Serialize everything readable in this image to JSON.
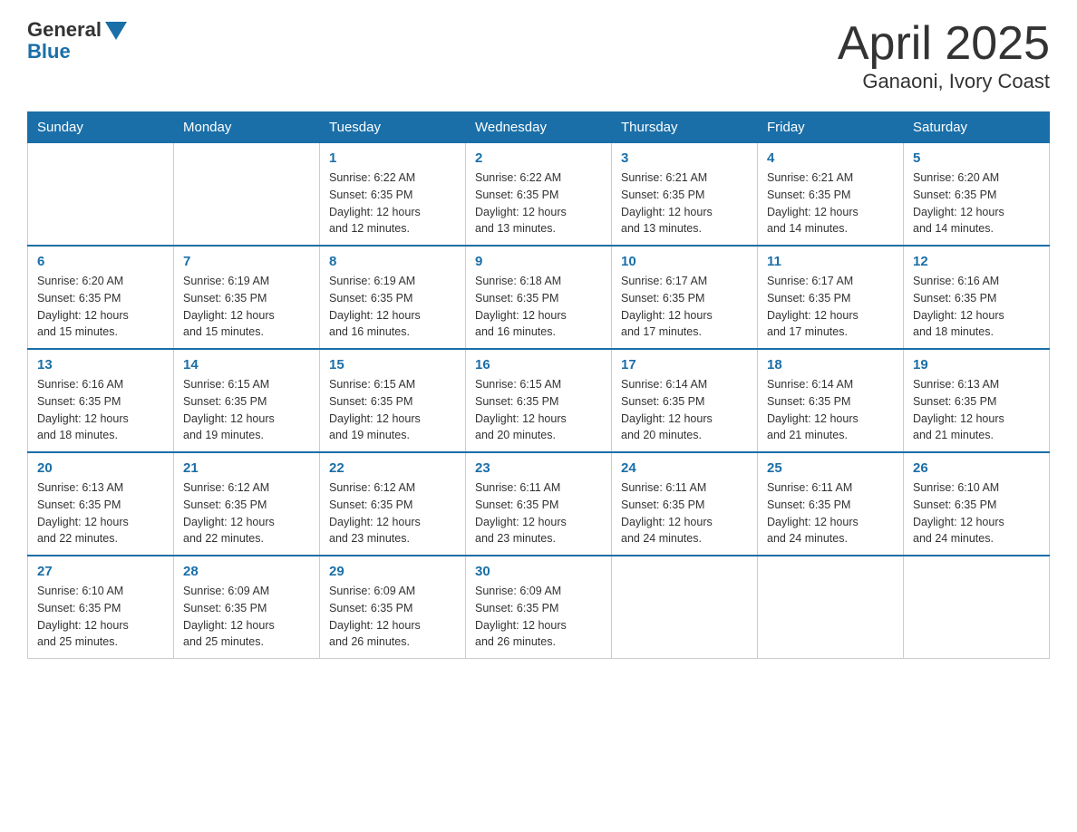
{
  "header": {
    "logo_general": "General",
    "logo_blue": "Blue",
    "title": "April 2025",
    "subtitle": "Ganaoni, Ivory Coast"
  },
  "days_of_week": [
    "Sunday",
    "Monday",
    "Tuesday",
    "Wednesday",
    "Thursday",
    "Friday",
    "Saturday"
  ],
  "weeks": [
    [
      {
        "day": "",
        "info": ""
      },
      {
        "day": "",
        "info": ""
      },
      {
        "day": "1",
        "info": "Sunrise: 6:22 AM\nSunset: 6:35 PM\nDaylight: 12 hours\nand 12 minutes."
      },
      {
        "day": "2",
        "info": "Sunrise: 6:22 AM\nSunset: 6:35 PM\nDaylight: 12 hours\nand 13 minutes."
      },
      {
        "day": "3",
        "info": "Sunrise: 6:21 AM\nSunset: 6:35 PM\nDaylight: 12 hours\nand 13 minutes."
      },
      {
        "day": "4",
        "info": "Sunrise: 6:21 AM\nSunset: 6:35 PM\nDaylight: 12 hours\nand 14 minutes."
      },
      {
        "day": "5",
        "info": "Sunrise: 6:20 AM\nSunset: 6:35 PM\nDaylight: 12 hours\nand 14 minutes."
      }
    ],
    [
      {
        "day": "6",
        "info": "Sunrise: 6:20 AM\nSunset: 6:35 PM\nDaylight: 12 hours\nand 15 minutes."
      },
      {
        "day": "7",
        "info": "Sunrise: 6:19 AM\nSunset: 6:35 PM\nDaylight: 12 hours\nand 15 minutes."
      },
      {
        "day": "8",
        "info": "Sunrise: 6:19 AM\nSunset: 6:35 PM\nDaylight: 12 hours\nand 16 minutes."
      },
      {
        "day": "9",
        "info": "Sunrise: 6:18 AM\nSunset: 6:35 PM\nDaylight: 12 hours\nand 16 minutes."
      },
      {
        "day": "10",
        "info": "Sunrise: 6:17 AM\nSunset: 6:35 PM\nDaylight: 12 hours\nand 17 minutes."
      },
      {
        "day": "11",
        "info": "Sunrise: 6:17 AM\nSunset: 6:35 PM\nDaylight: 12 hours\nand 17 minutes."
      },
      {
        "day": "12",
        "info": "Sunrise: 6:16 AM\nSunset: 6:35 PM\nDaylight: 12 hours\nand 18 minutes."
      }
    ],
    [
      {
        "day": "13",
        "info": "Sunrise: 6:16 AM\nSunset: 6:35 PM\nDaylight: 12 hours\nand 18 minutes."
      },
      {
        "day": "14",
        "info": "Sunrise: 6:15 AM\nSunset: 6:35 PM\nDaylight: 12 hours\nand 19 minutes."
      },
      {
        "day": "15",
        "info": "Sunrise: 6:15 AM\nSunset: 6:35 PM\nDaylight: 12 hours\nand 19 minutes."
      },
      {
        "day": "16",
        "info": "Sunrise: 6:15 AM\nSunset: 6:35 PM\nDaylight: 12 hours\nand 20 minutes."
      },
      {
        "day": "17",
        "info": "Sunrise: 6:14 AM\nSunset: 6:35 PM\nDaylight: 12 hours\nand 20 minutes."
      },
      {
        "day": "18",
        "info": "Sunrise: 6:14 AM\nSunset: 6:35 PM\nDaylight: 12 hours\nand 21 minutes."
      },
      {
        "day": "19",
        "info": "Sunrise: 6:13 AM\nSunset: 6:35 PM\nDaylight: 12 hours\nand 21 minutes."
      }
    ],
    [
      {
        "day": "20",
        "info": "Sunrise: 6:13 AM\nSunset: 6:35 PM\nDaylight: 12 hours\nand 22 minutes."
      },
      {
        "day": "21",
        "info": "Sunrise: 6:12 AM\nSunset: 6:35 PM\nDaylight: 12 hours\nand 22 minutes."
      },
      {
        "day": "22",
        "info": "Sunrise: 6:12 AM\nSunset: 6:35 PM\nDaylight: 12 hours\nand 23 minutes."
      },
      {
        "day": "23",
        "info": "Sunrise: 6:11 AM\nSunset: 6:35 PM\nDaylight: 12 hours\nand 23 minutes."
      },
      {
        "day": "24",
        "info": "Sunrise: 6:11 AM\nSunset: 6:35 PM\nDaylight: 12 hours\nand 24 minutes."
      },
      {
        "day": "25",
        "info": "Sunrise: 6:11 AM\nSunset: 6:35 PM\nDaylight: 12 hours\nand 24 minutes."
      },
      {
        "day": "26",
        "info": "Sunrise: 6:10 AM\nSunset: 6:35 PM\nDaylight: 12 hours\nand 24 minutes."
      }
    ],
    [
      {
        "day": "27",
        "info": "Sunrise: 6:10 AM\nSunset: 6:35 PM\nDaylight: 12 hours\nand 25 minutes."
      },
      {
        "day": "28",
        "info": "Sunrise: 6:09 AM\nSunset: 6:35 PM\nDaylight: 12 hours\nand 25 minutes."
      },
      {
        "day": "29",
        "info": "Sunrise: 6:09 AM\nSunset: 6:35 PM\nDaylight: 12 hours\nand 26 minutes."
      },
      {
        "day": "30",
        "info": "Sunrise: 6:09 AM\nSunset: 6:35 PM\nDaylight: 12 hours\nand 26 minutes."
      },
      {
        "day": "",
        "info": ""
      },
      {
        "day": "",
        "info": ""
      },
      {
        "day": "",
        "info": ""
      }
    ]
  ]
}
